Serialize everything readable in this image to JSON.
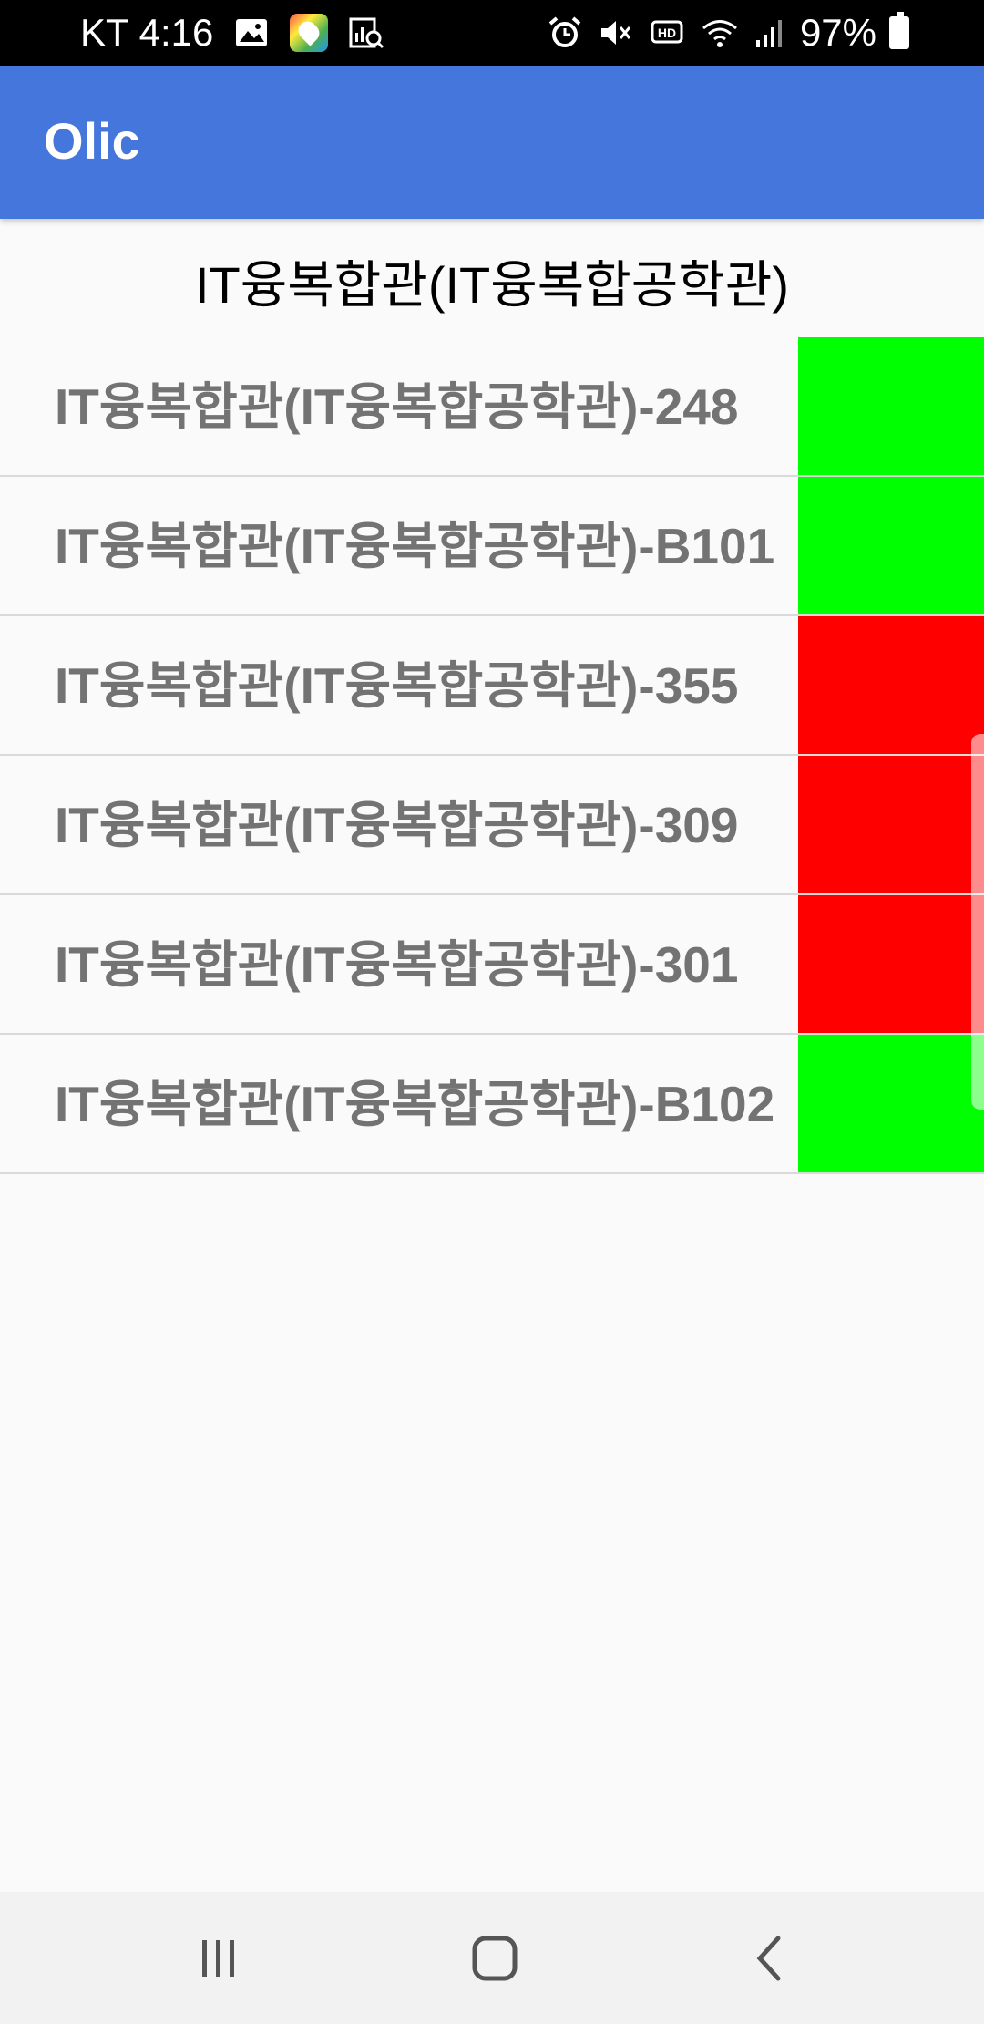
{
  "status_bar": {
    "carrier_time": "KT 4:16",
    "battery": "97%",
    "left_icons": [
      "gallery-icon",
      "map-app-icon",
      "analytics-icon"
    ],
    "right_icons": [
      "alarm-icon",
      "mute-icon",
      "hd-voice-icon",
      "wifi-icon",
      "signal-icon",
      "battery-icon"
    ]
  },
  "app_bar": {
    "title": "Olic",
    "color": "#4476dc"
  },
  "building": {
    "title": "IT융복합관(IT융복합공학관)"
  },
  "rooms": [
    {
      "name": "IT융복합관(IT융복합공학관)-248",
      "status_color": "#00ff00"
    },
    {
      "name": "IT융복합관(IT융복합공학관)-B101",
      "status_color": "#00ff00"
    },
    {
      "name": "IT융복합관(IT융복합공학관)-355",
      "status_color": "#ff0000"
    },
    {
      "name": "IT융복합관(IT융복합공학관)-309",
      "status_color": "#ff0000"
    },
    {
      "name": "IT융복합관(IT융복합공학관)-301",
      "status_color": "#ff0000"
    },
    {
      "name": "IT융복합관(IT융복합공학관)-B102",
      "status_color": "#00ff00"
    }
  ],
  "nav_bar": {
    "buttons": [
      "recent-apps",
      "home",
      "back"
    ]
  }
}
